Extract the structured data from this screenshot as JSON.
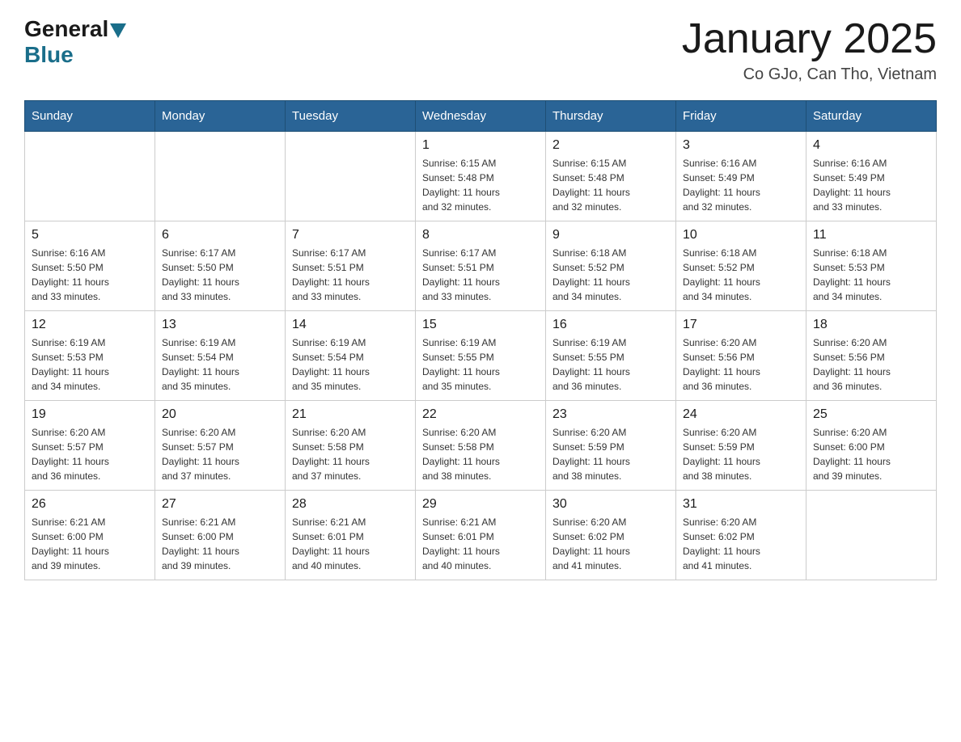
{
  "header": {
    "logo_general": "General",
    "logo_blue": "Blue",
    "month_title": "January 2025",
    "subtitle": "Co GJo, Can Tho, Vietnam"
  },
  "days_of_week": [
    "Sunday",
    "Monday",
    "Tuesday",
    "Wednesday",
    "Thursday",
    "Friday",
    "Saturday"
  ],
  "weeks": [
    [
      {
        "day": "",
        "info": ""
      },
      {
        "day": "",
        "info": ""
      },
      {
        "day": "",
        "info": ""
      },
      {
        "day": "1",
        "info": "Sunrise: 6:15 AM\nSunset: 5:48 PM\nDaylight: 11 hours\nand 32 minutes."
      },
      {
        "day": "2",
        "info": "Sunrise: 6:15 AM\nSunset: 5:48 PM\nDaylight: 11 hours\nand 32 minutes."
      },
      {
        "day": "3",
        "info": "Sunrise: 6:16 AM\nSunset: 5:49 PM\nDaylight: 11 hours\nand 32 minutes."
      },
      {
        "day": "4",
        "info": "Sunrise: 6:16 AM\nSunset: 5:49 PM\nDaylight: 11 hours\nand 33 minutes."
      }
    ],
    [
      {
        "day": "5",
        "info": "Sunrise: 6:16 AM\nSunset: 5:50 PM\nDaylight: 11 hours\nand 33 minutes."
      },
      {
        "day": "6",
        "info": "Sunrise: 6:17 AM\nSunset: 5:50 PM\nDaylight: 11 hours\nand 33 minutes."
      },
      {
        "day": "7",
        "info": "Sunrise: 6:17 AM\nSunset: 5:51 PM\nDaylight: 11 hours\nand 33 minutes."
      },
      {
        "day": "8",
        "info": "Sunrise: 6:17 AM\nSunset: 5:51 PM\nDaylight: 11 hours\nand 33 minutes."
      },
      {
        "day": "9",
        "info": "Sunrise: 6:18 AM\nSunset: 5:52 PM\nDaylight: 11 hours\nand 34 minutes."
      },
      {
        "day": "10",
        "info": "Sunrise: 6:18 AM\nSunset: 5:52 PM\nDaylight: 11 hours\nand 34 minutes."
      },
      {
        "day": "11",
        "info": "Sunrise: 6:18 AM\nSunset: 5:53 PM\nDaylight: 11 hours\nand 34 minutes."
      }
    ],
    [
      {
        "day": "12",
        "info": "Sunrise: 6:19 AM\nSunset: 5:53 PM\nDaylight: 11 hours\nand 34 minutes."
      },
      {
        "day": "13",
        "info": "Sunrise: 6:19 AM\nSunset: 5:54 PM\nDaylight: 11 hours\nand 35 minutes."
      },
      {
        "day": "14",
        "info": "Sunrise: 6:19 AM\nSunset: 5:54 PM\nDaylight: 11 hours\nand 35 minutes."
      },
      {
        "day": "15",
        "info": "Sunrise: 6:19 AM\nSunset: 5:55 PM\nDaylight: 11 hours\nand 35 minutes."
      },
      {
        "day": "16",
        "info": "Sunrise: 6:19 AM\nSunset: 5:55 PM\nDaylight: 11 hours\nand 36 minutes."
      },
      {
        "day": "17",
        "info": "Sunrise: 6:20 AM\nSunset: 5:56 PM\nDaylight: 11 hours\nand 36 minutes."
      },
      {
        "day": "18",
        "info": "Sunrise: 6:20 AM\nSunset: 5:56 PM\nDaylight: 11 hours\nand 36 minutes."
      }
    ],
    [
      {
        "day": "19",
        "info": "Sunrise: 6:20 AM\nSunset: 5:57 PM\nDaylight: 11 hours\nand 36 minutes."
      },
      {
        "day": "20",
        "info": "Sunrise: 6:20 AM\nSunset: 5:57 PM\nDaylight: 11 hours\nand 37 minutes."
      },
      {
        "day": "21",
        "info": "Sunrise: 6:20 AM\nSunset: 5:58 PM\nDaylight: 11 hours\nand 37 minutes."
      },
      {
        "day": "22",
        "info": "Sunrise: 6:20 AM\nSunset: 5:58 PM\nDaylight: 11 hours\nand 38 minutes."
      },
      {
        "day": "23",
        "info": "Sunrise: 6:20 AM\nSunset: 5:59 PM\nDaylight: 11 hours\nand 38 minutes."
      },
      {
        "day": "24",
        "info": "Sunrise: 6:20 AM\nSunset: 5:59 PM\nDaylight: 11 hours\nand 38 minutes."
      },
      {
        "day": "25",
        "info": "Sunrise: 6:20 AM\nSunset: 6:00 PM\nDaylight: 11 hours\nand 39 minutes."
      }
    ],
    [
      {
        "day": "26",
        "info": "Sunrise: 6:21 AM\nSunset: 6:00 PM\nDaylight: 11 hours\nand 39 minutes."
      },
      {
        "day": "27",
        "info": "Sunrise: 6:21 AM\nSunset: 6:00 PM\nDaylight: 11 hours\nand 39 minutes."
      },
      {
        "day": "28",
        "info": "Sunrise: 6:21 AM\nSunset: 6:01 PM\nDaylight: 11 hours\nand 40 minutes."
      },
      {
        "day": "29",
        "info": "Sunrise: 6:21 AM\nSunset: 6:01 PM\nDaylight: 11 hours\nand 40 minutes."
      },
      {
        "day": "30",
        "info": "Sunrise: 6:20 AM\nSunset: 6:02 PM\nDaylight: 11 hours\nand 41 minutes."
      },
      {
        "day": "31",
        "info": "Sunrise: 6:20 AM\nSunset: 6:02 PM\nDaylight: 11 hours\nand 41 minutes."
      },
      {
        "day": "",
        "info": ""
      }
    ]
  ]
}
